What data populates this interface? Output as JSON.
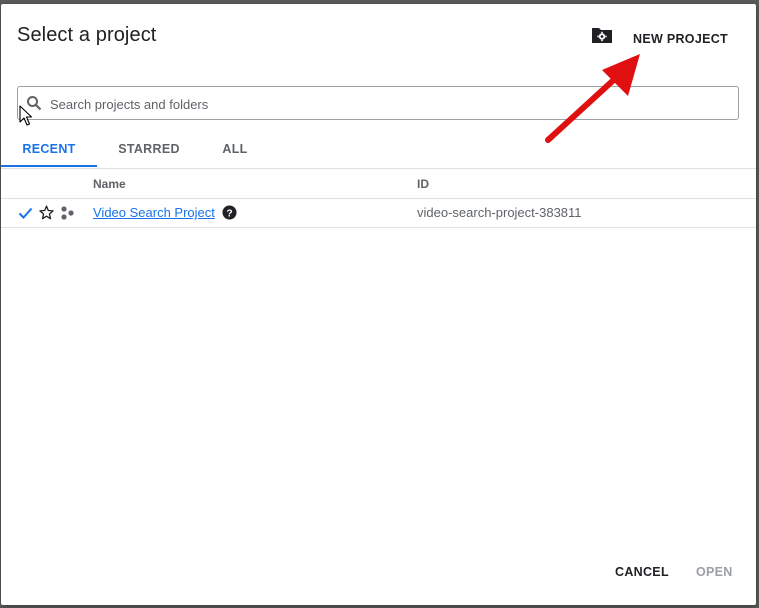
{
  "dialog": {
    "title": "Select a project",
    "new_project_label": "NEW PROJECT"
  },
  "search": {
    "placeholder": "Search projects and folders"
  },
  "tabs": [
    {
      "label": "RECENT",
      "active": true
    },
    {
      "label": "STARRED",
      "active": false
    },
    {
      "label": "ALL",
      "active": false
    }
  ],
  "table": {
    "columns": [
      "Name",
      "ID"
    ],
    "rows": [
      {
        "name": "Video Search Project",
        "id": "video-search-project-383811",
        "selected": true,
        "starred": false
      }
    ]
  },
  "footer": {
    "cancel_label": "CANCEL",
    "open_label": "OPEN"
  },
  "colors": {
    "accent": "#1a73e8",
    "annotation_arrow": "#e01010"
  }
}
